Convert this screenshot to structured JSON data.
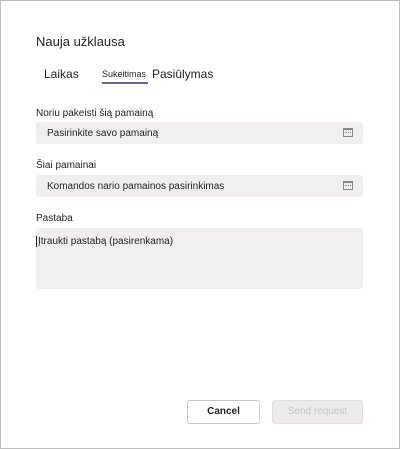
{
  "dialog": {
    "title": "Nauja užklausa",
    "tabs": {
      "time_off": "Laikas",
      "swap": "Sukeitimas",
      "offer": "Pasiūlymas"
    },
    "swap_field": {
      "label": "Noriu pakeisti šią pamainą",
      "placeholder": "Pasirinkite savo pamainą",
      "icon": "calendar-icon"
    },
    "for_field": {
      "label": "Šiai pamainai",
      "placeholder": "Komandos nario pamainos pasirinkimas",
      "icon": "calendar-icon"
    },
    "note_field": {
      "label": "Pastaba",
      "placeholder": "Įtraukti pastabą (pasirenkama)"
    },
    "buttons": {
      "cancel": "Cancel",
      "send": "Send request"
    },
    "colors": {
      "accent": "#6264a7",
      "field_bg": "#f1efee",
      "disabled_text": "#c8c6c4"
    }
  }
}
